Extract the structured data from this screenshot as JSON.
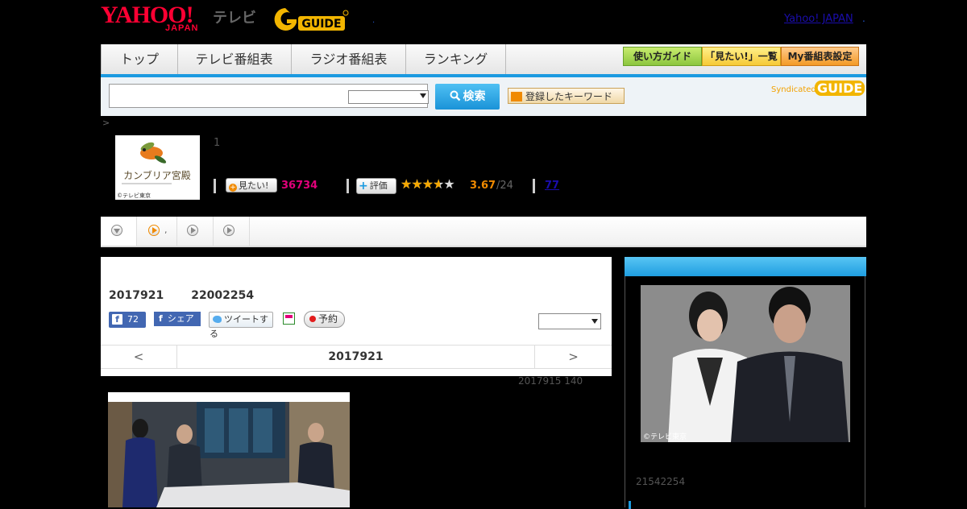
{
  "header": {
    "yahoo_logo_top": "YAHOO!",
    "yahoo_logo_bottom": "JAPAN",
    "tv_label": "テレビ",
    "gguide_logo": "G-GUIDE",
    "yahoo_japan_link": "Yahoo! JAPAN",
    "dot": "."
  },
  "nav": {
    "tabs": [
      "トップ",
      "テレビ番組表",
      "ラジオ番組表",
      "ランキング"
    ],
    "buttons": [
      "使い方ガイド",
      "「見たい!」一覧",
      "My番組表設定"
    ]
  },
  "search": {
    "input_value": "",
    "select_value": "",
    "button_label": "検索",
    "keyword_button": "登録したキーワード",
    "syndicated_label": "Syndicated",
    "syndicated_logo": "GUIDE"
  },
  "breadcrumb": ">",
  "program": {
    "thumb_title": "カンブリア宮殿",
    "thumb_copyright": "©テレビ東京",
    "number": "1",
    "mitai_label": "見たい!",
    "mitai_count": "36734",
    "hyoka_label": "評価",
    "stars": "★★★★★",
    "rating_value": 3.67,
    "rating": "3.67",
    "rating_count": "/24",
    "review_link": "77"
  },
  "subtabs": {
    "comma": ","
  },
  "main": {
    "broadcast_date": "2017921",
    "broadcast_time": "22002254",
    "fb_like_count": "72",
    "fb_share_label": "シェア",
    "tweet_label": "ツイートする",
    "reserve_label": "予約",
    "select_value": "",
    "prev_day": "<",
    "current_date": "2017921",
    "next_day": ">"
  },
  "update_note": "2017915  140",
  "side": {
    "photo_copyright": "©テレビ東京",
    "note": "21542254"
  },
  "colors": {
    "accent_blue": "#1b9ae0",
    "pink": "#e2007a",
    "orange": "#f08a00",
    "facebook": "#4267b2"
  }
}
